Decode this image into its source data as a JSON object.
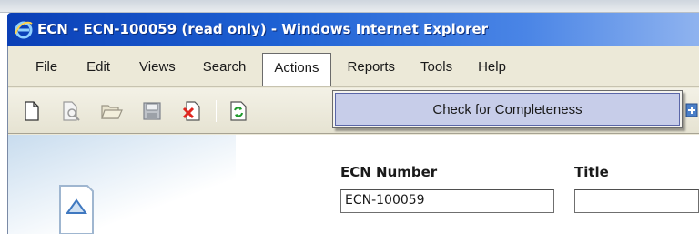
{
  "window": {
    "title": "ECN - ECN-100059 (read only) - Windows Internet Explorer"
  },
  "menubar": {
    "items": [
      {
        "label": "File"
      },
      {
        "label": "Edit"
      },
      {
        "label": "Views"
      },
      {
        "label": "Search"
      },
      {
        "label": "Actions",
        "active": true
      },
      {
        "label": "Reports"
      },
      {
        "label": "Tools"
      },
      {
        "label": "Help"
      }
    ]
  },
  "actions_menu": {
    "items": [
      {
        "label": "Check for Completeness"
      }
    ]
  },
  "toolbar": {
    "icons": [
      "new-document-icon",
      "print-preview-icon",
      "open-folder-icon",
      "save-icon",
      "delete-icon",
      "refresh-icon",
      "add-icon"
    ]
  },
  "form": {
    "ecn_number": {
      "label": "ECN Number",
      "value": "ECN-100059"
    },
    "title": {
      "label": "Title",
      "value": ""
    }
  },
  "colors": {
    "titlebar_start": "#0a3fb6",
    "titlebar_end": "#8fb3ef",
    "menu_highlight": "#c7cde9",
    "chrome": "#ece9d8"
  }
}
